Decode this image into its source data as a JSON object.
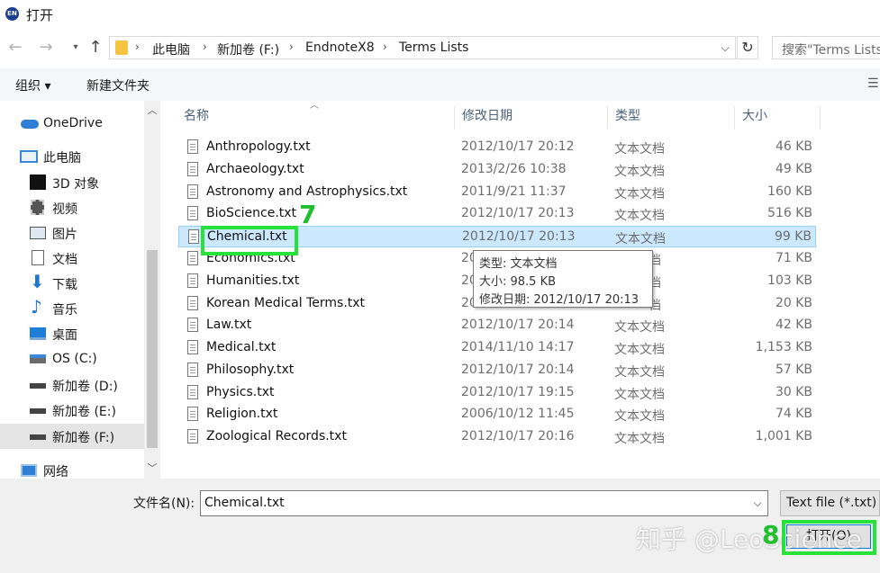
{
  "window": {
    "app_icon_text": "EN",
    "title": "打开"
  },
  "address": {
    "breadcrumbs": [
      "此电脑",
      "新加卷 (F:)",
      "EndnoteX8",
      "Terms Lists"
    ],
    "search_placeholder": "搜索\"Terms Lists\""
  },
  "toolbar": {
    "organize": "组织 ▾",
    "new_folder": "新建文件夹"
  },
  "nav": {
    "items": [
      {
        "label": "OneDrive",
        "icon": "cloud-icon"
      },
      {
        "label": "此电脑",
        "icon": "computer-icon"
      },
      {
        "label": "3D 对象",
        "icon": "3d-objects-icon"
      },
      {
        "label": "视频",
        "icon": "video-icon"
      },
      {
        "label": "图片",
        "icon": "picture-icon"
      },
      {
        "label": "文档",
        "icon": "document-icon"
      },
      {
        "label": "下载",
        "icon": "download-icon"
      },
      {
        "label": "音乐",
        "icon": "music-icon"
      },
      {
        "label": "桌面",
        "icon": "desktop-icon"
      },
      {
        "label": "OS (C:)",
        "icon": "drive-c-icon"
      },
      {
        "label": "新加卷 (D:)",
        "icon": "drive-icon"
      },
      {
        "label": "新加卷 (E:)",
        "icon": "drive-icon"
      },
      {
        "label": "新加卷 (F:)",
        "icon": "drive-icon"
      },
      {
        "label": "网络",
        "icon": "network-icon"
      }
    ]
  },
  "columns": {
    "name": "名称",
    "date": "修改日期",
    "type": "类型",
    "size": "大小"
  },
  "files": [
    {
      "name": "Anthropology.txt",
      "date": "2012/10/17 20:12",
      "type": "文本文档",
      "size": "46 KB"
    },
    {
      "name": "Archaeology.txt",
      "date": "2013/2/26 10:38",
      "type": "文本文档",
      "size": "49 KB"
    },
    {
      "name": "Astronomy and Astrophysics.txt",
      "date": "2011/9/21 11:37",
      "type": "文本文档",
      "size": "160 KB"
    },
    {
      "name": "BioScience.txt",
      "date": "2012/10/17 20:13",
      "type": "文本文档",
      "size": "516 KB"
    },
    {
      "name": "Chemical.txt",
      "date": "2012/10/17 20:13",
      "type": "文本文档",
      "size": "99 KB"
    },
    {
      "name": "Economics.txt",
      "date": "20",
      "type": "档",
      "size": "71 KB"
    },
    {
      "name": "Humanities.txt",
      "date": "20",
      "type": "档",
      "size": "103 KB"
    },
    {
      "name": "Korean Medical Terms.txt",
      "date": "20",
      "type": "档",
      "size": "20 KB"
    },
    {
      "name": "Law.txt",
      "date": "2012/10/17 20:14",
      "type": "文本文档",
      "size": "42 KB"
    },
    {
      "name": "Medical.txt",
      "date": "2014/11/10 14:17",
      "type": "文本文档",
      "size": "1,153 KB"
    },
    {
      "name": "Philosophy.txt",
      "date": "2012/10/17 20:14",
      "type": "文本文档",
      "size": "57 KB"
    },
    {
      "name": "Physics.txt",
      "date": "2012/10/17 19:15",
      "type": "文本文档",
      "size": "30 KB"
    },
    {
      "name": "Religion.txt",
      "date": "2006/10/12 11:45",
      "type": "文本文档",
      "size": "74 KB"
    },
    {
      "name": "Zoological Records.txt",
      "date": "2012/10/17 20:16",
      "type": "文本文档",
      "size": "1,001 KB"
    }
  ],
  "tooltip": {
    "type": "类型: 文本文档",
    "size": "大小: 98.5 KB",
    "date": "修改日期: 2012/10/17 20:13"
  },
  "footer": {
    "filename_label": "文件名(N):",
    "filename_value": "Chemical.txt",
    "filetype": "Text file  (*.txt)",
    "open_label": "打开(O)"
  },
  "annotations": {
    "step7": "7",
    "step8": "8",
    "watermark": "知乎 @LeoScience"
  },
  "colors": {
    "selection_bg": "#cce8ff",
    "annotation_green": "#27e23b",
    "header_text": "#4c607a"
  }
}
